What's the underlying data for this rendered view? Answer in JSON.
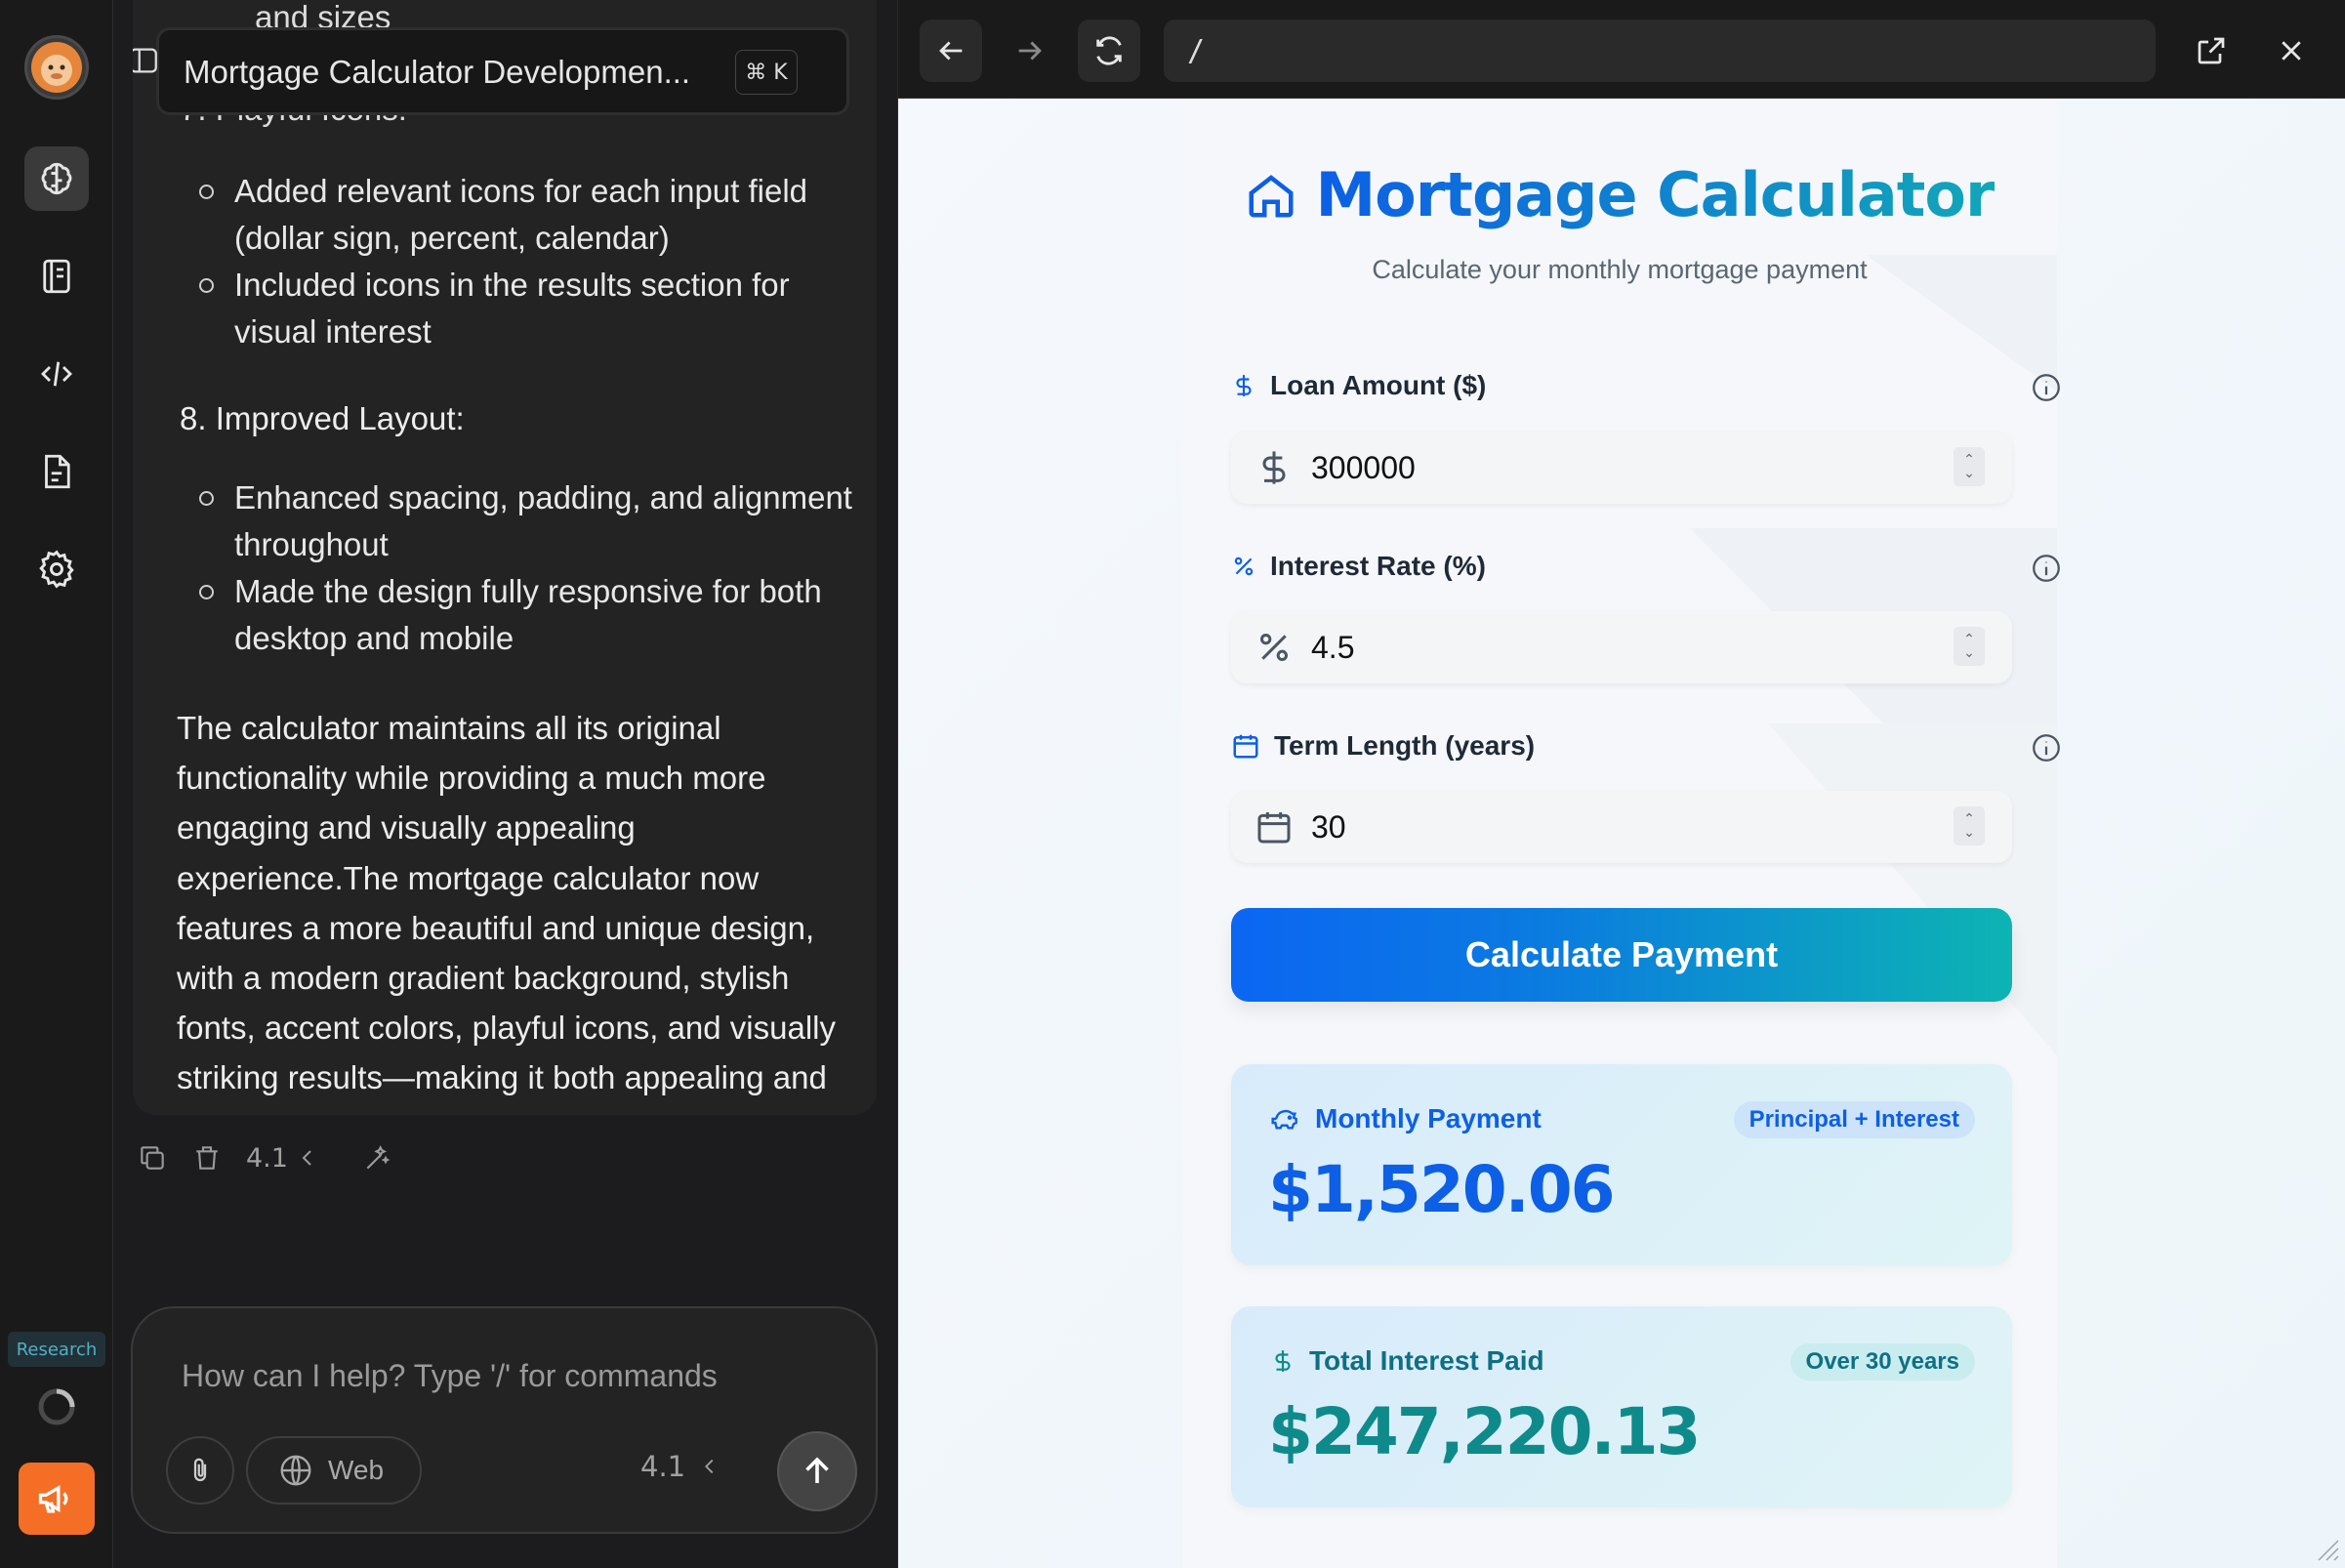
{
  "chat": {
    "title": "Mortgage Calculator Developmen...",
    "shortcut": "⌘ K",
    "cut_top_text": "and sizes",
    "cut_heading": "7. Playful Icons:",
    "playful_icons": [
      "Added relevant icons for each input field (dollar sign, percent, calendar)",
      "Included icons in the results section for visual interest"
    ],
    "improved_layout_heading": "8. Improved Layout:",
    "improved_layout": [
      "Enhanced spacing, padding, and alignment throughout",
      "Made the design fully responsive for both desktop and mobile"
    ],
    "summary": "The calculator maintains all its original functionality while providing a much more engaging and visually appealing experience.The mortgage calculator now features a more beautiful and unique design, with a modern gradient background, stylish fonts, accent colors, playful icons, and visually striking results—making it both appealing and easy to use.",
    "message_version": "4.1",
    "composer": {
      "placeholder": "How can I help? Type '/' for commands",
      "web_label": "Web",
      "model_version": "4.1"
    }
  },
  "rail": {
    "research_label": "Research",
    "accent": "#f46f25"
  },
  "browser": {
    "url": "/"
  },
  "calculator": {
    "title": "Mortgage Calculator",
    "subtitle": "Calculate your monthly mortgage payment",
    "fields": {
      "loan": {
        "label": "Loan Amount ($)",
        "value": "300000",
        "icon": "dollar-icon"
      },
      "rate": {
        "label": "Interest Rate (%)",
        "value": "4.5",
        "icon": "percent-icon"
      },
      "term": {
        "label": "Term Length (years)",
        "value": "30",
        "icon": "calendar-icon"
      }
    },
    "button_label": "Calculate Payment",
    "monthly": {
      "label": "Monthly Payment",
      "badge": "Principal + Interest",
      "value": "$1,520.06"
    },
    "interest": {
      "label": "Total Interest Paid",
      "badge": "Over 30 years",
      "value": "$247,220.13"
    },
    "colors": {
      "primary": "#0d5fe5",
      "teal": "#0f8a8a",
      "gradient_end": "#0db4b3"
    }
  }
}
